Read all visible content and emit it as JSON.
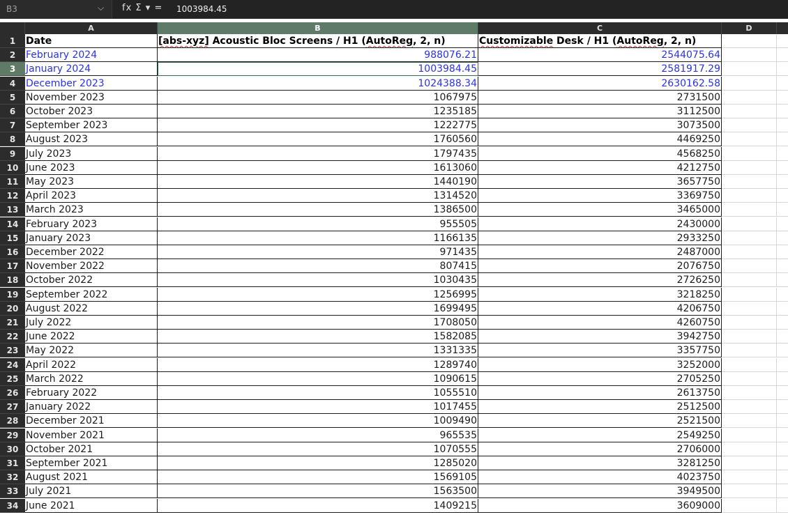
{
  "formula_bar": {
    "cell_ref": "B3",
    "chevron_icon": "chevron-down-icon",
    "function_icon": "fx",
    "sum_icon": "Σ",
    "dropdown_icon": "▾",
    "equals_icon": "=",
    "value": "1003984.45"
  },
  "columns": [
    "A",
    "B",
    "C",
    "D"
  ],
  "header": {
    "row_num": "1",
    "a": "Date",
    "b_prefix": "[abs-xyz]",
    "b_rest": " Acoustic Bloc Screens / H1 (",
    "b_sq": "AutoReg",
    "b_end": ", 2, n)",
    "c_sq1": "Customizable",
    "c_mid": " Desk / H1 (",
    "c_sq2": "AutoReg",
    "c_end": ", 2, n)"
  },
  "colors": {
    "forecast_text": "#2a33e8",
    "selected_header": "#5f7a66",
    "header_bg": "#2c2c2c"
  },
  "rows": [
    {
      "n": "2",
      "date": "February 2024",
      "b": "988076.21",
      "c": "2544075.64"
    },
    {
      "n": "3",
      "date": "January 2024",
      "b": "1003984.45",
      "c": "2581917.29"
    },
    {
      "n": "4",
      "date": "December 2023",
      "b": "1024388.34",
      "c": "2630162.58"
    },
    {
      "n": "5",
      "date": "November 2023",
      "b": "1067975",
      "c": "2731500"
    },
    {
      "n": "6",
      "date": "October 2023",
      "b": "1235185",
      "c": "3112500"
    },
    {
      "n": "7",
      "date": "September 2023",
      "b": "1222775",
      "c": "3073500"
    },
    {
      "n": "8",
      "date": "August 2023",
      "b": "1760560",
      "c": "4469250"
    },
    {
      "n": "9",
      "date": "July 2023",
      "b": "1797435",
      "c": "4568250"
    },
    {
      "n": "10",
      "date": "June 2023",
      "b": "1613060",
      "c": "4212750"
    },
    {
      "n": "11",
      "date": "May 2023",
      "b": "1440190",
      "c": "3657750"
    },
    {
      "n": "12",
      "date": "April 2023",
      "b": "1314520",
      "c": "3369750"
    },
    {
      "n": "13",
      "date": "March 2023",
      "b": "1386500",
      "c": "3465000"
    },
    {
      "n": "14",
      "date": "February 2023",
      "b": "955505",
      "c": "2430000"
    },
    {
      "n": "15",
      "date": "January 2023",
      "b": "1166135",
      "c": "2933250"
    },
    {
      "n": "16",
      "date": "December 2022",
      "b": "971435",
      "c": "2487000"
    },
    {
      "n": "17",
      "date": "November 2022",
      "b": "807415",
      "c": "2076750"
    },
    {
      "n": "18",
      "date": "October 2022",
      "b": "1030435",
      "c": "2726250"
    },
    {
      "n": "19",
      "date": "September 2022",
      "b": "1256995",
      "c": "3218250"
    },
    {
      "n": "20",
      "date": "August 2022",
      "b": "1699495",
      "c": "4206750"
    },
    {
      "n": "21",
      "date": "July 2022",
      "b": "1708050",
      "c": "4260750"
    },
    {
      "n": "22",
      "date": "June 2022",
      "b": "1582085",
      "c": "3942750"
    },
    {
      "n": "23",
      "date": "May 2022",
      "b": "1331335",
      "c": "3357750"
    },
    {
      "n": "24",
      "date": "April 2022",
      "b": "1289740",
      "c": "3252000"
    },
    {
      "n": "25",
      "date": "March 2022",
      "b": "1090615",
      "c": "2705250"
    },
    {
      "n": "26",
      "date": "February 2022",
      "b": "1055510",
      "c": "2613750"
    },
    {
      "n": "27",
      "date": "January 2022",
      "b": "1017455",
      "c": "2512500"
    },
    {
      "n": "28",
      "date": "December 2021",
      "b": "1009490",
      "c": "2521500"
    },
    {
      "n": "29",
      "date": "November 2021",
      "b": "965535",
      "c": "2549250"
    },
    {
      "n": "30",
      "date": "October 2021",
      "b": "1070555",
      "c": "2706000"
    },
    {
      "n": "31",
      "date": "September 2021",
      "b": "1285020",
      "c": "3281250"
    },
    {
      "n": "32",
      "date": "August 2021",
      "b": "1569105",
      "c": "4023750"
    },
    {
      "n": "33",
      "date": "July 2021",
      "b": "1563500",
      "c": "3949500"
    },
    {
      "n": "34",
      "date": "June 2021",
      "b": "1409215",
      "c": "3609000"
    }
  ]
}
